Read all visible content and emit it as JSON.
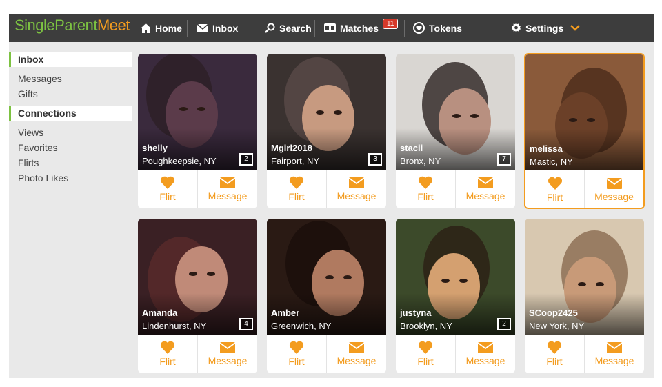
{
  "brand": {
    "part1": "SingleParent",
    "part2": "Meet"
  },
  "nav": {
    "home": "Home",
    "inbox": "Inbox",
    "search": "Search",
    "matches": "Matches",
    "matches_badge": "11",
    "tokens": "Tokens",
    "settings": "Settings"
  },
  "sidebar": {
    "inbox_head": "Inbox",
    "inbox_items": [
      "Messages",
      "Gifts"
    ],
    "connections_head": "Connections",
    "connection_items": [
      "Views",
      "Favorites",
      "Flirts",
      "Photo Likes"
    ]
  },
  "actions": {
    "flirt": "Flirt",
    "message": "Message"
  },
  "profiles": [
    {
      "name": "shelly",
      "location": "Poughkeepsie, NY",
      "photos": "2"
    },
    {
      "name": "Mgirl2018",
      "location": "Fairport, NY",
      "photos": "3"
    },
    {
      "name": "stacii",
      "location": "Bronx, NY",
      "photos": "7"
    },
    {
      "name": "melissa",
      "location": "Mastic, NY",
      "photos": ""
    },
    {
      "name": "Amanda",
      "location": "Lindenhurst, NY",
      "photos": "4"
    },
    {
      "name": "Amber",
      "location": "Greenwich, NY",
      "photos": ""
    },
    {
      "name": "justyna",
      "location": "Brooklyn, NY",
      "photos": "2"
    },
    {
      "name": "SCoop2425",
      "location": "New York, NY",
      "photos": ""
    }
  ],
  "colors": {
    "brand_green": "#7dc242",
    "brand_orange": "#f39c1f",
    "topbar": "#3d3d3d",
    "badge_red": "#d63a2a"
  }
}
